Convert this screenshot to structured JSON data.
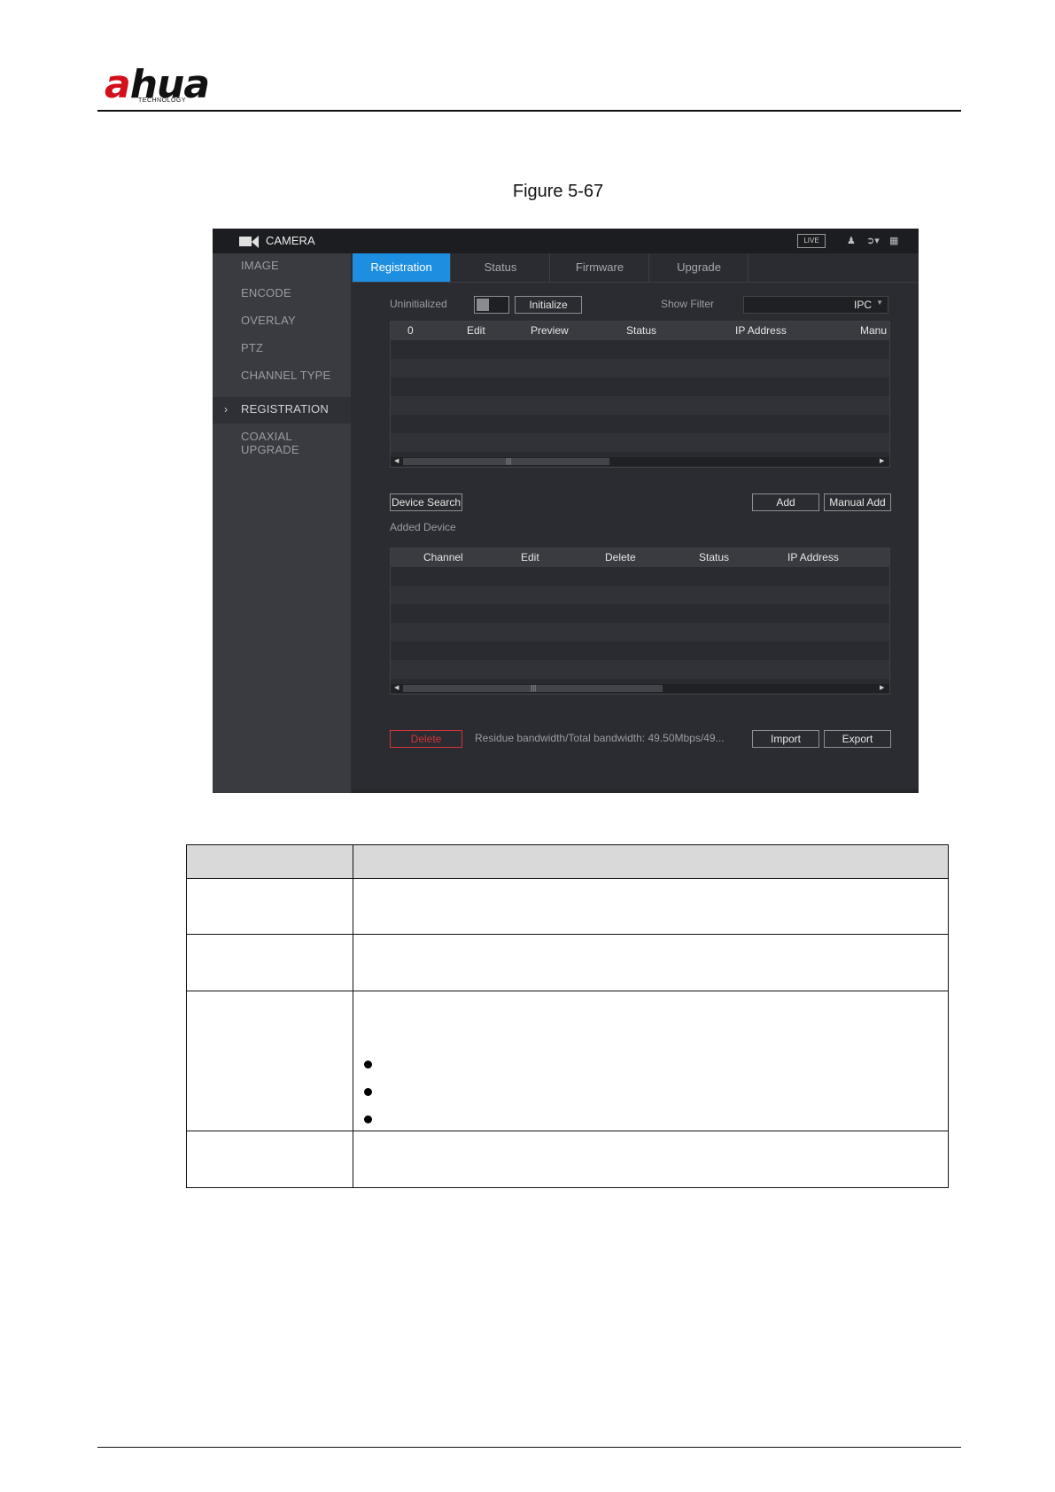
{
  "header": {
    "logo_text_a": "a",
    "logo_text_rest": "hua",
    "logo_sub": "TECHNOLOGY"
  },
  "caption": "Figure 5-67",
  "window": {
    "title": "CAMERA",
    "live_badge": "LIVE",
    "icons": [
      "user-icon",
      "logout-icon",
      "grid-icon"
    ]
  },
  "sidebar": {
    "items": [
      {
        "label": "IMAGE"
      },
      {
        "label": "ENCODE"
      },
      {
        "label": "OVERLAY"
      },
      {
        "label": "PTZ"
      },
      {
        "label": "CHANNEL TYPE"
      },
      {
        "label": "REGISTRATION"
      },
      {
        "label": "COAXIAL UPGRADE"
      }
    ],
    "active": "REGISTRATION"
  },
  "tabs": [
    {
      "label": "Registration"
    },
    {
      "label": "Status"
    },
    {
      "label": "Firmware"
    },
    {
      "label": "Upgrade"
    }
  ],
  "toolbar": {
    "uninitialized_label": "Uninitialized",
    "initialize_button": "Initialize",
    "show_filter_label": "Show Filter",
    "filter_value": "IPC"
  },
  "search_table": {
    "columns": [
      "0",
      "Edit",
      "Preview",
      "Status",
      "IP Address",
      "Manu"
    ]
  },
  "actions": {
    "device_search": "Device Search",
    "add": "Add",
    "manual_add": "Manual Add",
    "added_device_label": "Added Device"
  },
  "added_table": {
    "columns": [
      "Channel",
      "Edit",
      "Delete",
      "Status",
      "IP Address"
    ]
  },
  "bottom": {
    "delete": "Delete",
    "bandwidth": "Residue bandwidth/Total bandwidth:  49.50Mbps/49...",
    "import": "Import",
    "export": "Export"
  },
  "colors": {
    "accent": "#1e8fe0",
    "danger": "#d2333a",
    "brand_red": "#d40f1c"
  }
}
